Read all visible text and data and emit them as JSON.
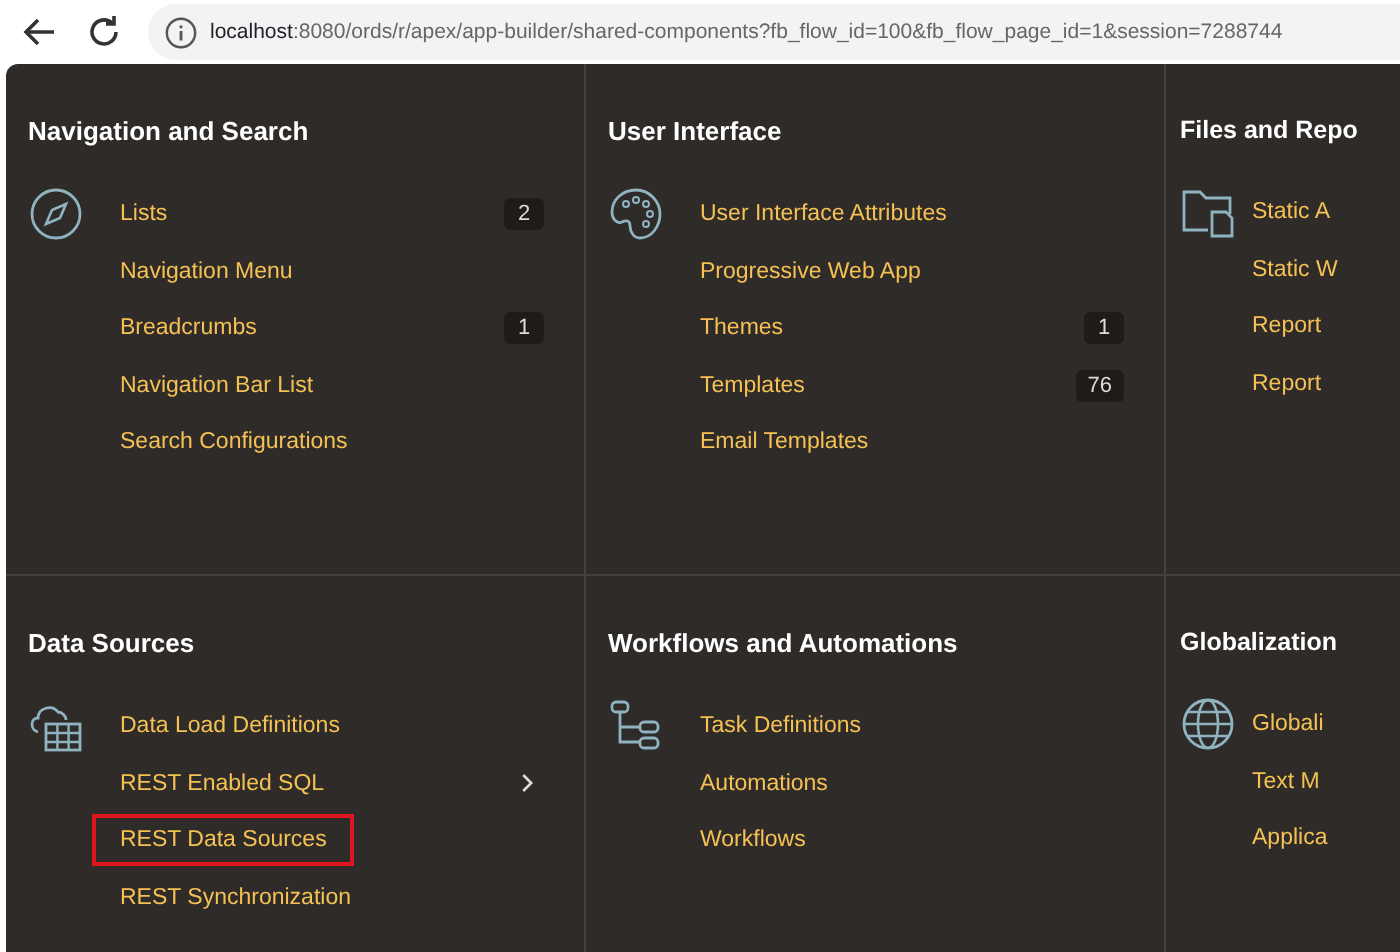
{
  "browser": {
    "url_host": "localhost",
    "url_rest": ":8080/ords/r/apex/app-builder/shared-components?fb_flow_id=100&fb_flow_page_id=1&session=7288744"
  },
  "sections": [
    {
      "title": "Navigation and Search",
      "items": [
        {
          "label": "Lists",
          "count": "2"
        },
        {
          "label": "Navigation Menu"
        },
        {
          "label": "Breadcrumbs",
          "count": "1"
        },
        {
          "label": "Navigation Bar List"
        },
        {
          "label": "Search Configurations"
        }
      ]
    },
    {
      "title": "User Interface",
      "items": [
        {
          "label": "User Interface Attributes"
        },
        {
          "label": "Progressive Web App"
        },
        {
          "label": "Themes",
          "count": "1"
        },
        {
          "label": "Templates",
          "count": "76"
        },
        {
          "label": "Email Templates"
        }
      ]
    },
    {
      "title": "Files and Repo",
      "items": [
        {
          "label": "Static A"
        },
        {
          "label": "Static W"
        },
        {
          "label": "Report"
        },
        {
          "label": "Report"
        }
      ]
    },
    {
      "title": "Data Sources",
      "items": [
        {
          "label": "Data Load Definitions"
        },
        {
          "label": "REST Enabled SQL",
          "submenu": true
        },
        {
          "label": "REST Data Sources",
          "highlighted": true
        },
        {
          "label": "REST Synchronization"
        }
      ]
    },
    {
      "title": "Workflows and Automations",
      "items": [
        {
          "label": "Task Definitions"
        },
        {
          "label": "Automations"
        },
        {
          "label": "Workflows"
        }
      ]
    },
    {
      "title": "Globalization",
      "items": [
        {
          "label": "Globali"
        },
        {
          "label": "Text M"
        },
        {
          "label": "Applica"
        }
      ]
    }
  ]
}
